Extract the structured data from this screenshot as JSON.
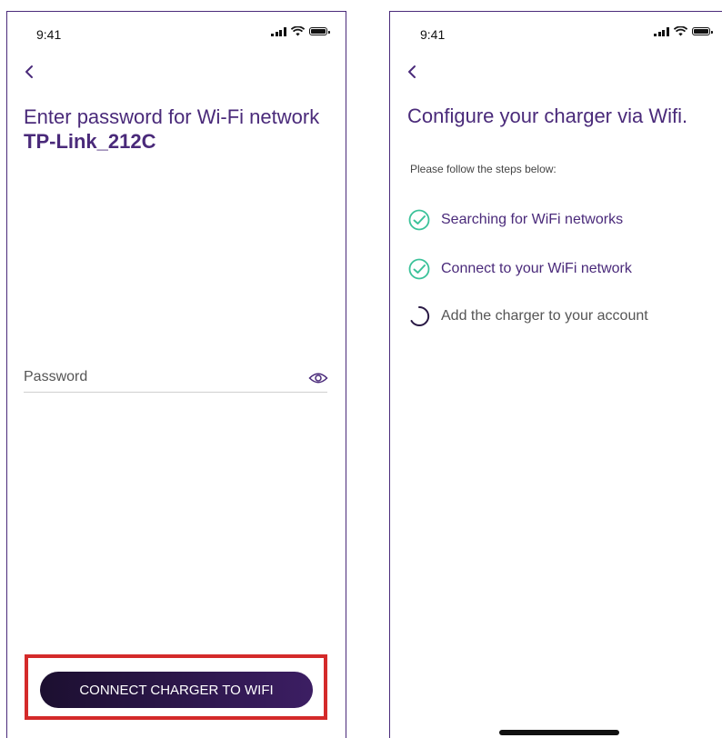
{
  "left_screen": {
    "status_time": "9:41",
    "title_prefix": "Enter password for Wi-Fi network",
    "network_name": "TP-Link_212C",
    "password_placeholder": "Password",
    "connect_button_label": "CONNECT CHARGER TO WIFI"
  },
  "right_screen": {
    "status_time": "9:41",
    "title": "Configure your charger via Wifi.",
    "subtitle": "Please follow the steps below:",
    "steps": [
      {
        "label": "Searching for WiFi networks",
        "status": "done"
      },
      {
        "label": "Connect to your WiFi network",
        "status": "done"
      },
      {
        "label": "Add the charger to your account",
        "status": "in-progress"
      }
    ]
  },
  "colors": {
    "brand_purple": "#4a2a7a",
    "check_green": "#3cc29a",
    "highlight_red": "#d42a2a",
    "button_gradient_start": "#1c0f30",
    "button_gradient_end": "#3c1e63"
  },
  "icons": {
    "back": "chevron-left-icon",
    "eye": "eye-icon",
    "step_done": "check-circle-icon",
    "step_progress": "spinner-icon"
  }
}
